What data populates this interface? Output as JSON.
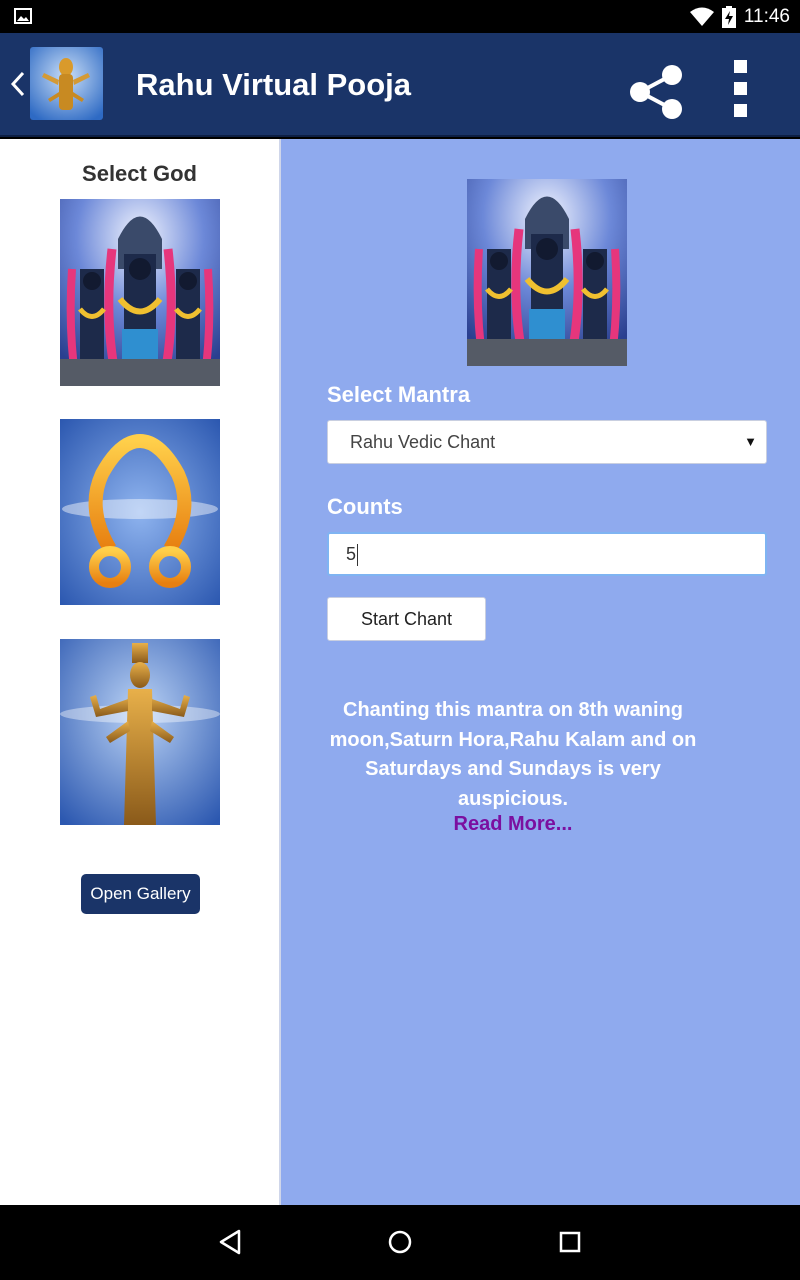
{
  "status_bar": {
    "time": "11:46",
    "icons": [
      "image-icon",
      "wifi-icon",
      "battery-charging-icon"
    ]
  },
  "app_bar": {
    "title": "Rahu Virtual Pooja",
    "icons": [
      "back-chevron-icon",
      "app-logo-icon",
      "share-icon",
      "overflow-menu-icon"
    ],
    "color": "#1a3468"
  },
  "left_pane": {
    "title": "Select God",
    "gods": [
      "god-trio-image",
      "rahu-symbol-image",
      "rahu-idol-image"
    ],
    "open_gallery_label": "Open Gallery"
  },
  "right_pane": {
    "background": "#8faaee",
    "select_mantra_label": "Select Mantra",
    "mantra_selected": "Rahu Vedic Chant",
    "counts_label": "Counts",
    "counts_value": "5",
    "start_chant_label": "Start Chant",
    "description": "Chanting this mantra on 8th waning moon,Saturn Hora,Rahu Kalam and on Saturdays and Sundays is very auspicious.",
    "read_more": "Read More..."
  },
  "nav_bar": {
    "icons": [
      "back-triangle-icon",
      "home-circle-icon",
      "recents-square-icon"
    ]
  }
}
